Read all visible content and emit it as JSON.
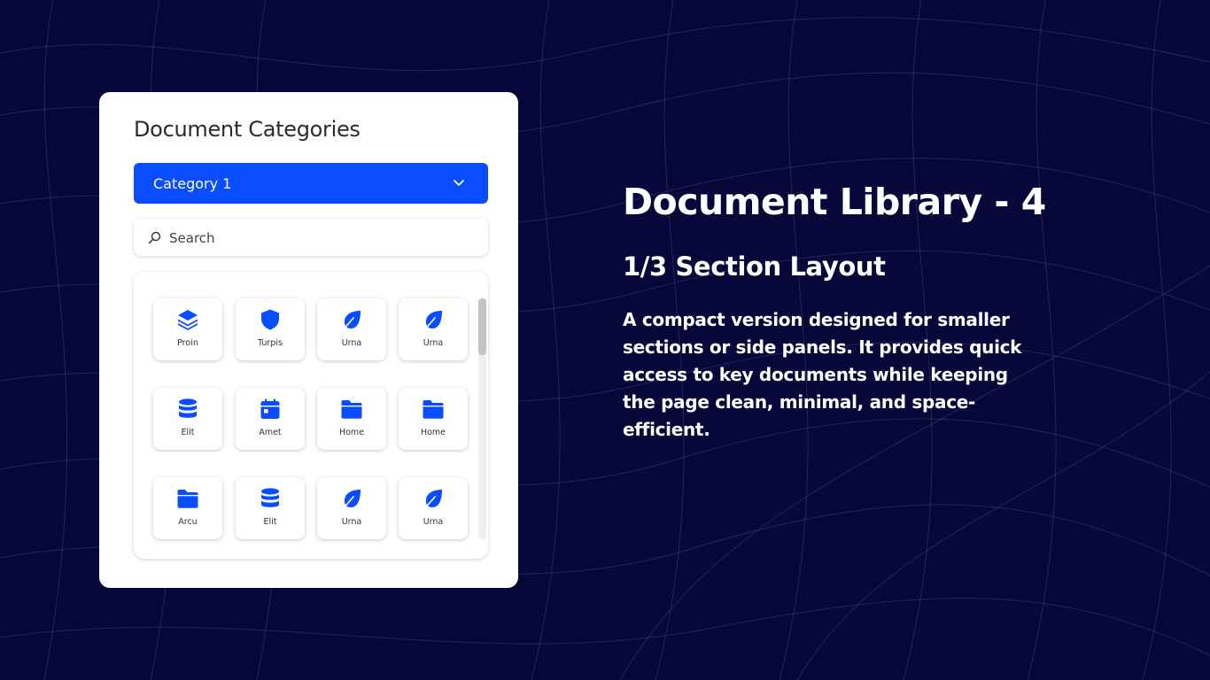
{
  "panel": {
    "title": "Document Categories",
    "dropdown_selected": "Category 1",
    "search_placeholder": "Search"
  },
  "tiles": [
    {
      "label": "Proin",
      "icon": "layers-icon"
    },
    {
      "label": "Turpis",
      "icon": "shield-icon"
    },
    {
      "label": "Urna",
      "icon": "leaf-icon"
    },
    {
      "label": "Urna",
      "icon": "leaf-icon"
    },
    {
      "label": "Elit",
      "icon": "database-icon"
    },
    {
      "label": "Amet",
      "icon": "calendar-icon"
    },
    {
      "label": "Home",
      "icon": "folder-icon"
    },
    {
      "label": "Home",
      "icon": "folder-icon"
    },
    {
      "label": "Arcu",
      "icon": "folder-icon"
    },
    {
      "label": "Elit",
      "icon": "database-icon"
    },
    {
      "label": "Urna",
      "icon": "leaf-icon"
    },
    {
      "label": "Urna",
      "icon": "leaf-icon"
    }
  ],
  "hero": {
    "title": "Document Library - 4",
    "subtitle": "1/3 Section Layout",
    "description": "A compact version designed for smaller sections or side panels. It provides quick access to key documents while keeping the page clean, minimal, and space-efficient."
  },
  "colors": {
    "background": "#07073a",
    "accent": "#0a4dff",
    "card": "#ffffff"
  }
}
